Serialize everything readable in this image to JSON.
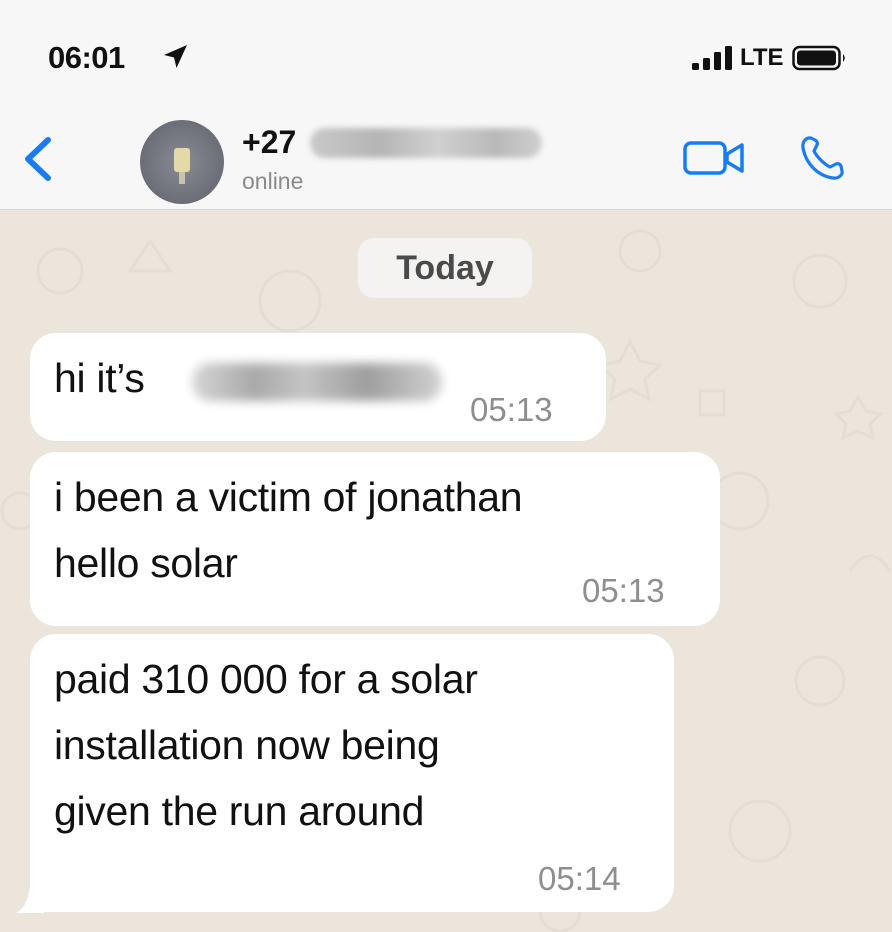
{
  "status_bar": {
    "time": "06:01",
    "network": "LTE",
    "icons": [
      "location-arrow-icon",
      "signal-bars-icon",
      "battery-icon"
    ]
  },
  "header": {
    "contact_code": "+27",
    "contact_status": "online",
    "icons": [
      "back-chevron-icon",
      "video-camera-icon",
      "phone-icon"
    ],
    "accent_color": "#1a7cf5"
  },
  "chat": {
    "date_label": "Today",
    "messages": [
      {
        "text": "hi it’s",
        "time": "05:13"
      },
      {
        "text": "i been a victim of jonathan\nhello solar",
        "time": "05:13"
      },
      {
        "text": "paid 310 000 for a solar\ninstallation now being\ngiven the run around",
        "time": "05:14"
      }
    ]
  }
}
